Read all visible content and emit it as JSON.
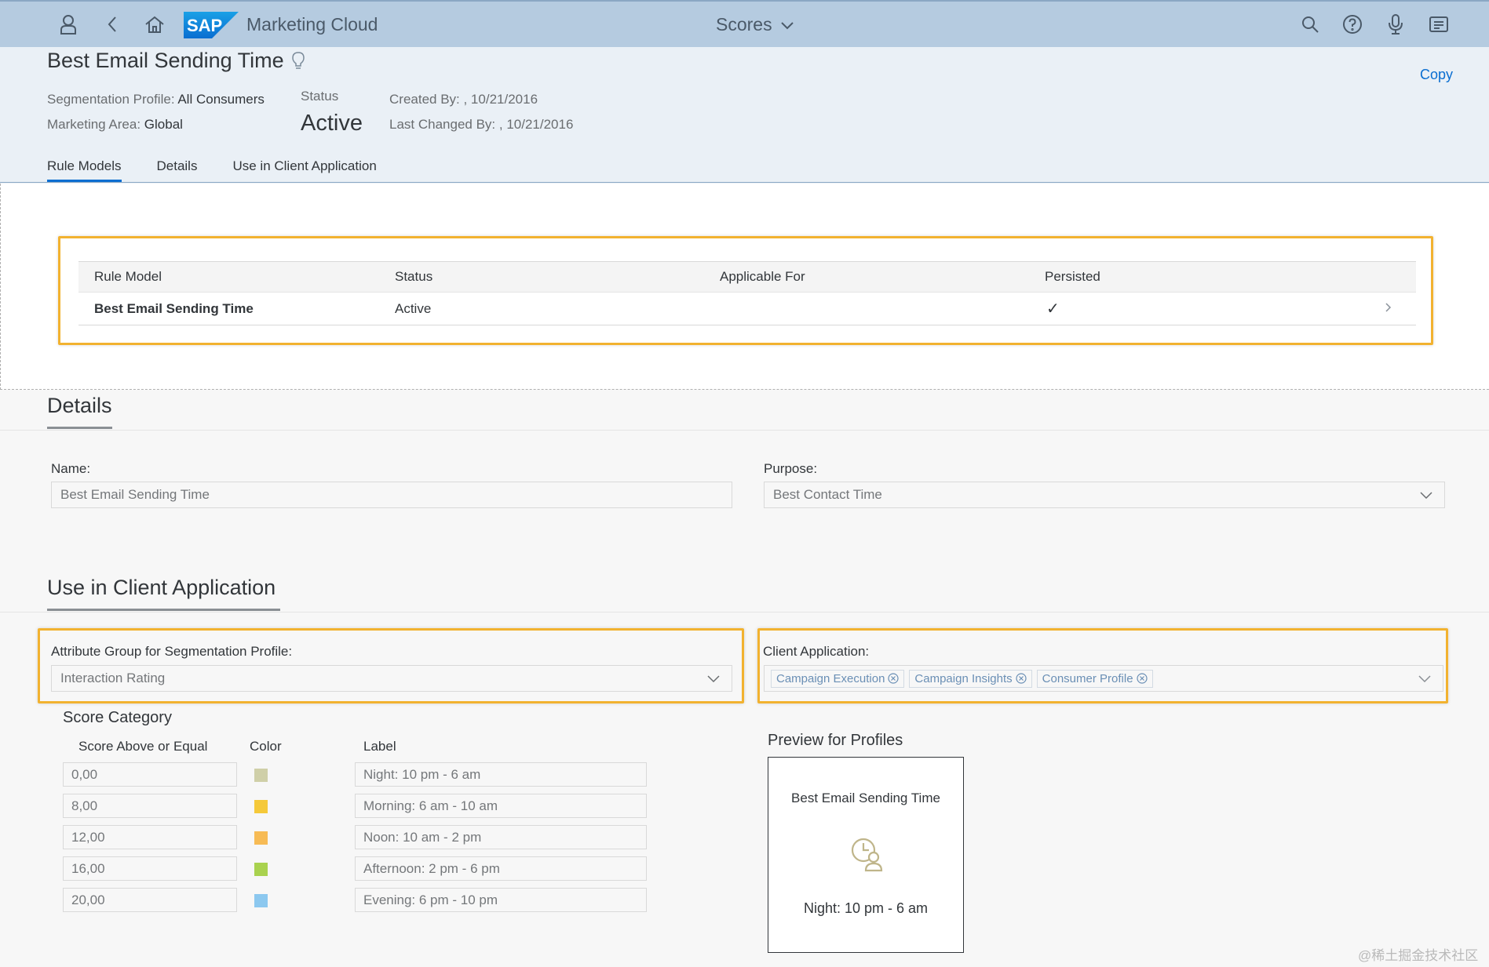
{
  "shell": {
    "app_title": "Marketing Cloud",
    "logo_text": "SAP",
    "center_menu": "Scores",
    "icons": [
      "user-icon",
      "back-icon",
      "home-icon",
      "search-icon",
      "help-icon",
      "microphone-icon",
      "notifications-icon"
    ]
  },
  "header": {
    "title": "Best Email Sending Time",
    "copy_label": "Copy",
    "segmentation_profile_label": "Segmentation Profile:",
    "segmentation_profile_value": "All Consumers",
    "marketing_area_label": "Marketing Area:",
    "marketing_area_value": "Global",
    "status_label": "Status",
    "status_value": "Active",
    "created_by": "Created By: , 10/21/2016",
    "last_changed_by": "Last Changed By: , 10/21/2016",
    "tabs": [
      {
        "label": "Rule Models",
        "active": true
      },
      {
        "label": "Details",
        "active": false
      },
      {
        "label": "Use in Client Application",
        "active": false
      }
    ]
  },
  "rule_models": {
    "columns": [
      "Rule Model",
      "Status",
      "Applicable For",
      "Persisted"
    ],
    "rows": [
      {
        "rule_model": "Best Email Sending Time",
        "status": "Active",
        "applicable_for": "",
        "persisted_mark": "✓"
      }
    ]
  },
  "details": {
    "title": "Details",
    "name_label": "Name:",
    "name_value": "Best Email Sending Time",
    "purpose_label": "Purpose:",
    "purpose_value": "Best Contact Time"
  },
  "client_app": {
    "title": "Use in Client Application",
    "attr_group_label": "Attribute Group for Segmentation Profile:",
    "attr_group_value": "Interaction Rating",
    "client_app_label": "Client Application:",
    "tokens": [
      "Campaign Execution",
      "Campaign Insights",
      "Consumer Profile"
    ]
  },
  "score_category": {
    "title": "Score Category",
    "col_score": "Score Above or Equal",
    "col_color": "Color",
    "col_label": "Label",
    "rows": [
      {
        "score": "0,00",
        "color": "#cfcfa8",
        "label": "Night: 10 pm - 6 am"
      },
      {
        "score": "8,00",
        "color": "#f5c93a",
        "label": "Morning: 6 am - 10 am"
      },
      {
        "score": "12,00",
        "color": "#f7bb55",
        "label": "Noon: 10 am - 2 pm"
      },
      {
        "score": "16,00",
        "color": "#a9d24f",
        "label": "Afternoon: 2 pm - 6 pm"
      },
      {
        "score": "20,00",
        "color": "#8cc8ef",
        "label": "Evening: 6 pm - 10 pm"
      }
    ]
  },
  "preview": {
    "title": "Preview for Profiles",
    "card_title": "Best Email Sending Time",
    "card_value": "Night: 10 pm - 6 am"
  },
  "watermark": "@稀土掘金技术社区",
  "colors": {
    "shell_bg": "#b5cbe0",
    "header_bg": "#eaf0f6",
    "highlight": "#f2b230",
    "link": "#0a6ed1"
  }
}
